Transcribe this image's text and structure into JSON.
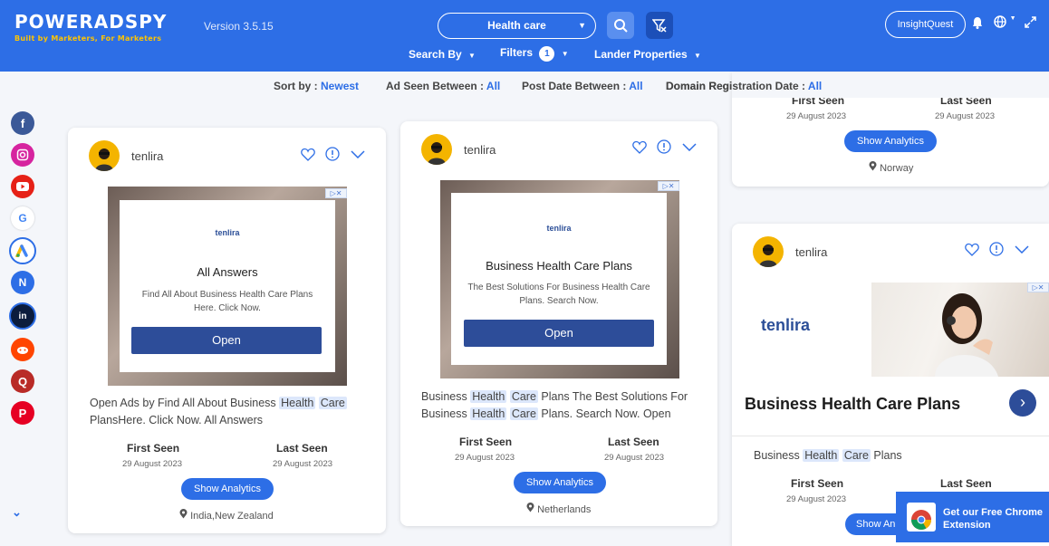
{
  "header": {
    "logo": "POWERADSPY",
    "tagline": "Built by Marketers, For Marketers",
    "version": "Version 3.5.15",
    "search_value": "Health care",
    "search_by": "Search By",
    "filters": "Filters",
    "filters_count": "1",
    "lander": "Lander Properties",
    "user": "InsightQuest"
  },
  "sort": {
    "sort_by_label": "Sort by : ",
    "sort_by_value": "Newest",
    "ad_seen_label": "Ad Seen Between : ",
    "ad_seen_value": "All",
    "post_date_label": "Post Date Between : ",
    "post_date_value": "All",
    "domain_label": "Domain Registration Date : ",
    "domain_value": "All"
  },
  "sidebar": {
    "networks": [
      "facebook",
      "instagram",
      "youtube",
      "google",
      "google-ads",
      "native",
      "linkedin",
      "reddit",
      "quora",
      "pinterest"
    ]
  },
  "cards": [
    {
      "advertiser": "tenlira",
      "ad_logo": "tenlira",
      "ad_title": "All Answers",
      "ad_desc": "Find All About Business Health Care Plans Here. Click Now.",
      "ad_button": "Open",
      "caption_pre": "Open Ads by Find All About Business ",
      "caption_hl1": "Health",
      "caption_hl2": "Care",
      "caption_post": "PlansHere. Click Now. All Answers",
      "first_seen_label": "First Seen",
      "first_seen": "29 August 2023",
      "last_seen_label": "Last Seen",
      "last_seen": "29 August 2023",
      "analytics": "Show Analytics",
      "location": "India,New Zealand"
    },
    {
      "advertiser": "tenlira",
      "ad_logo": "tenlira",
      "ad_title": "Business Health Care Plans",
      "ad_desc": "The Best Solutions For Business Health Care Plans. Search Now.",
      "ad_button": "Open",
      "caption_pre": "Business ",
      "caption_hl1": "Health",
      "caption_hl2": "Care",
      "caption_mid": " Plans The Best Solutions For Business ",
      "caption_hl3": "Health",
      "caption_hl4": "Care",
      "caption_post": " Plans. Search Now. Open",
      "first_seen_label": "First Seen",
      "first_seen": "29 August 2023",
      "last_seen_label": "Last Seen",
      "last_seen": "29 August 2023",
      "analytics": "Show Analytics",
      "location": "Netherlands"
    },
    {
      "first_seen_label": "First Seen",
      "first_seen": "29 August 2023",
      "last_seen_label": "Last Seen",
      "last_seen": "29 August 2023",
      "analytics": "Show Analytics",
      "location": "Norway"
    },
    {
      "advertiser": "tenlira",
      "ad_logo": "tenlira",
      "ad_title": "Business Health Care Plans",
      "caption_pre": "Business ",
      "caption_hl1": "Health",
      "caption_hl2": "Care",
      "caption_post": " Plans",
      "first_seen_label": "First Seen",
      "first_seen": "29 August 2023",
      "last_seen_label": "Last Seen",
      "analytics": "Show An"
    }
  ],
  "chrome_ext": "Get our Free Chrome Extension",
  "colors": {
    "brand": "#2d6ee6",
    "accent": "#ffc400",
    "highlight": "#dce7fb"
  }
}
